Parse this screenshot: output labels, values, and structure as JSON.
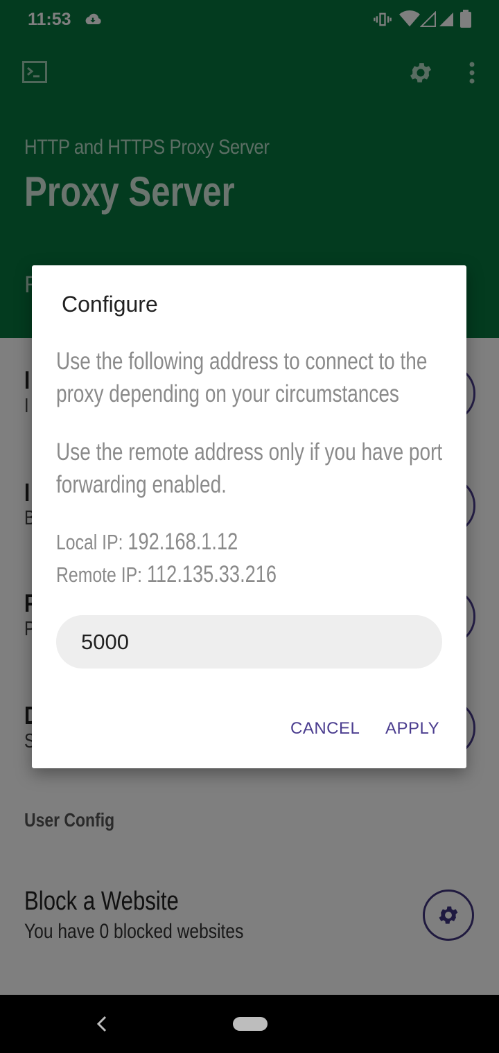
{
  "status_bar": {
    "time": "11:53"
  },
  "app_bar": {
    "subtitle": "HTTP and HTTPS Proxy Server",
    "title": "Proxy Server",
    "partial_label": "R"
  },
  "background_rows": [
    {
      "title": "I",
      "subtitle": "I"
    },
    {
      "title": "I",
      "subtitle": "B"
    },
    {
      "title": "P",
      "subtitle": "P"
    },
    {
      "title": "D",
      "subtitle": "S"
    }
  ],
  "user_config": {
    "section_label": "User Config",
    "block_title": "Block a Website",
    "block_subtitle": "You have 0 blocked websites"
  },
  "dialog": {
    "title": "Configure",
    "text1": "Use the following address to connect to the proxy depending on your circumstances",
    "text2": "Use the remote address only if you have port forwarding enabled.",
    "local_label": "Local IP: ",
    "local_ip": "192.168.1.12",
    "remote_label": "Remote IP: ",
    "remote_ip": "112.135.33.216",
    "port_value": "5000",
    "cancel_label": "CANCEL",
    "apply_label": "APPLY"
  },
  "colors": {
    "app_bar": "#06763f",
    "accent": "#4b3d8f"
  },
  "icons": [
    "cloud-icon",
    "vibrate-icon",
    "wifi-icon",
    "signal-icon",
    "battery-icon",
    "terminal-icon",
    "gear-icon",
    "more-vert-icon",
    "back-icon",
    "home-pill-icon"
  ]
}
